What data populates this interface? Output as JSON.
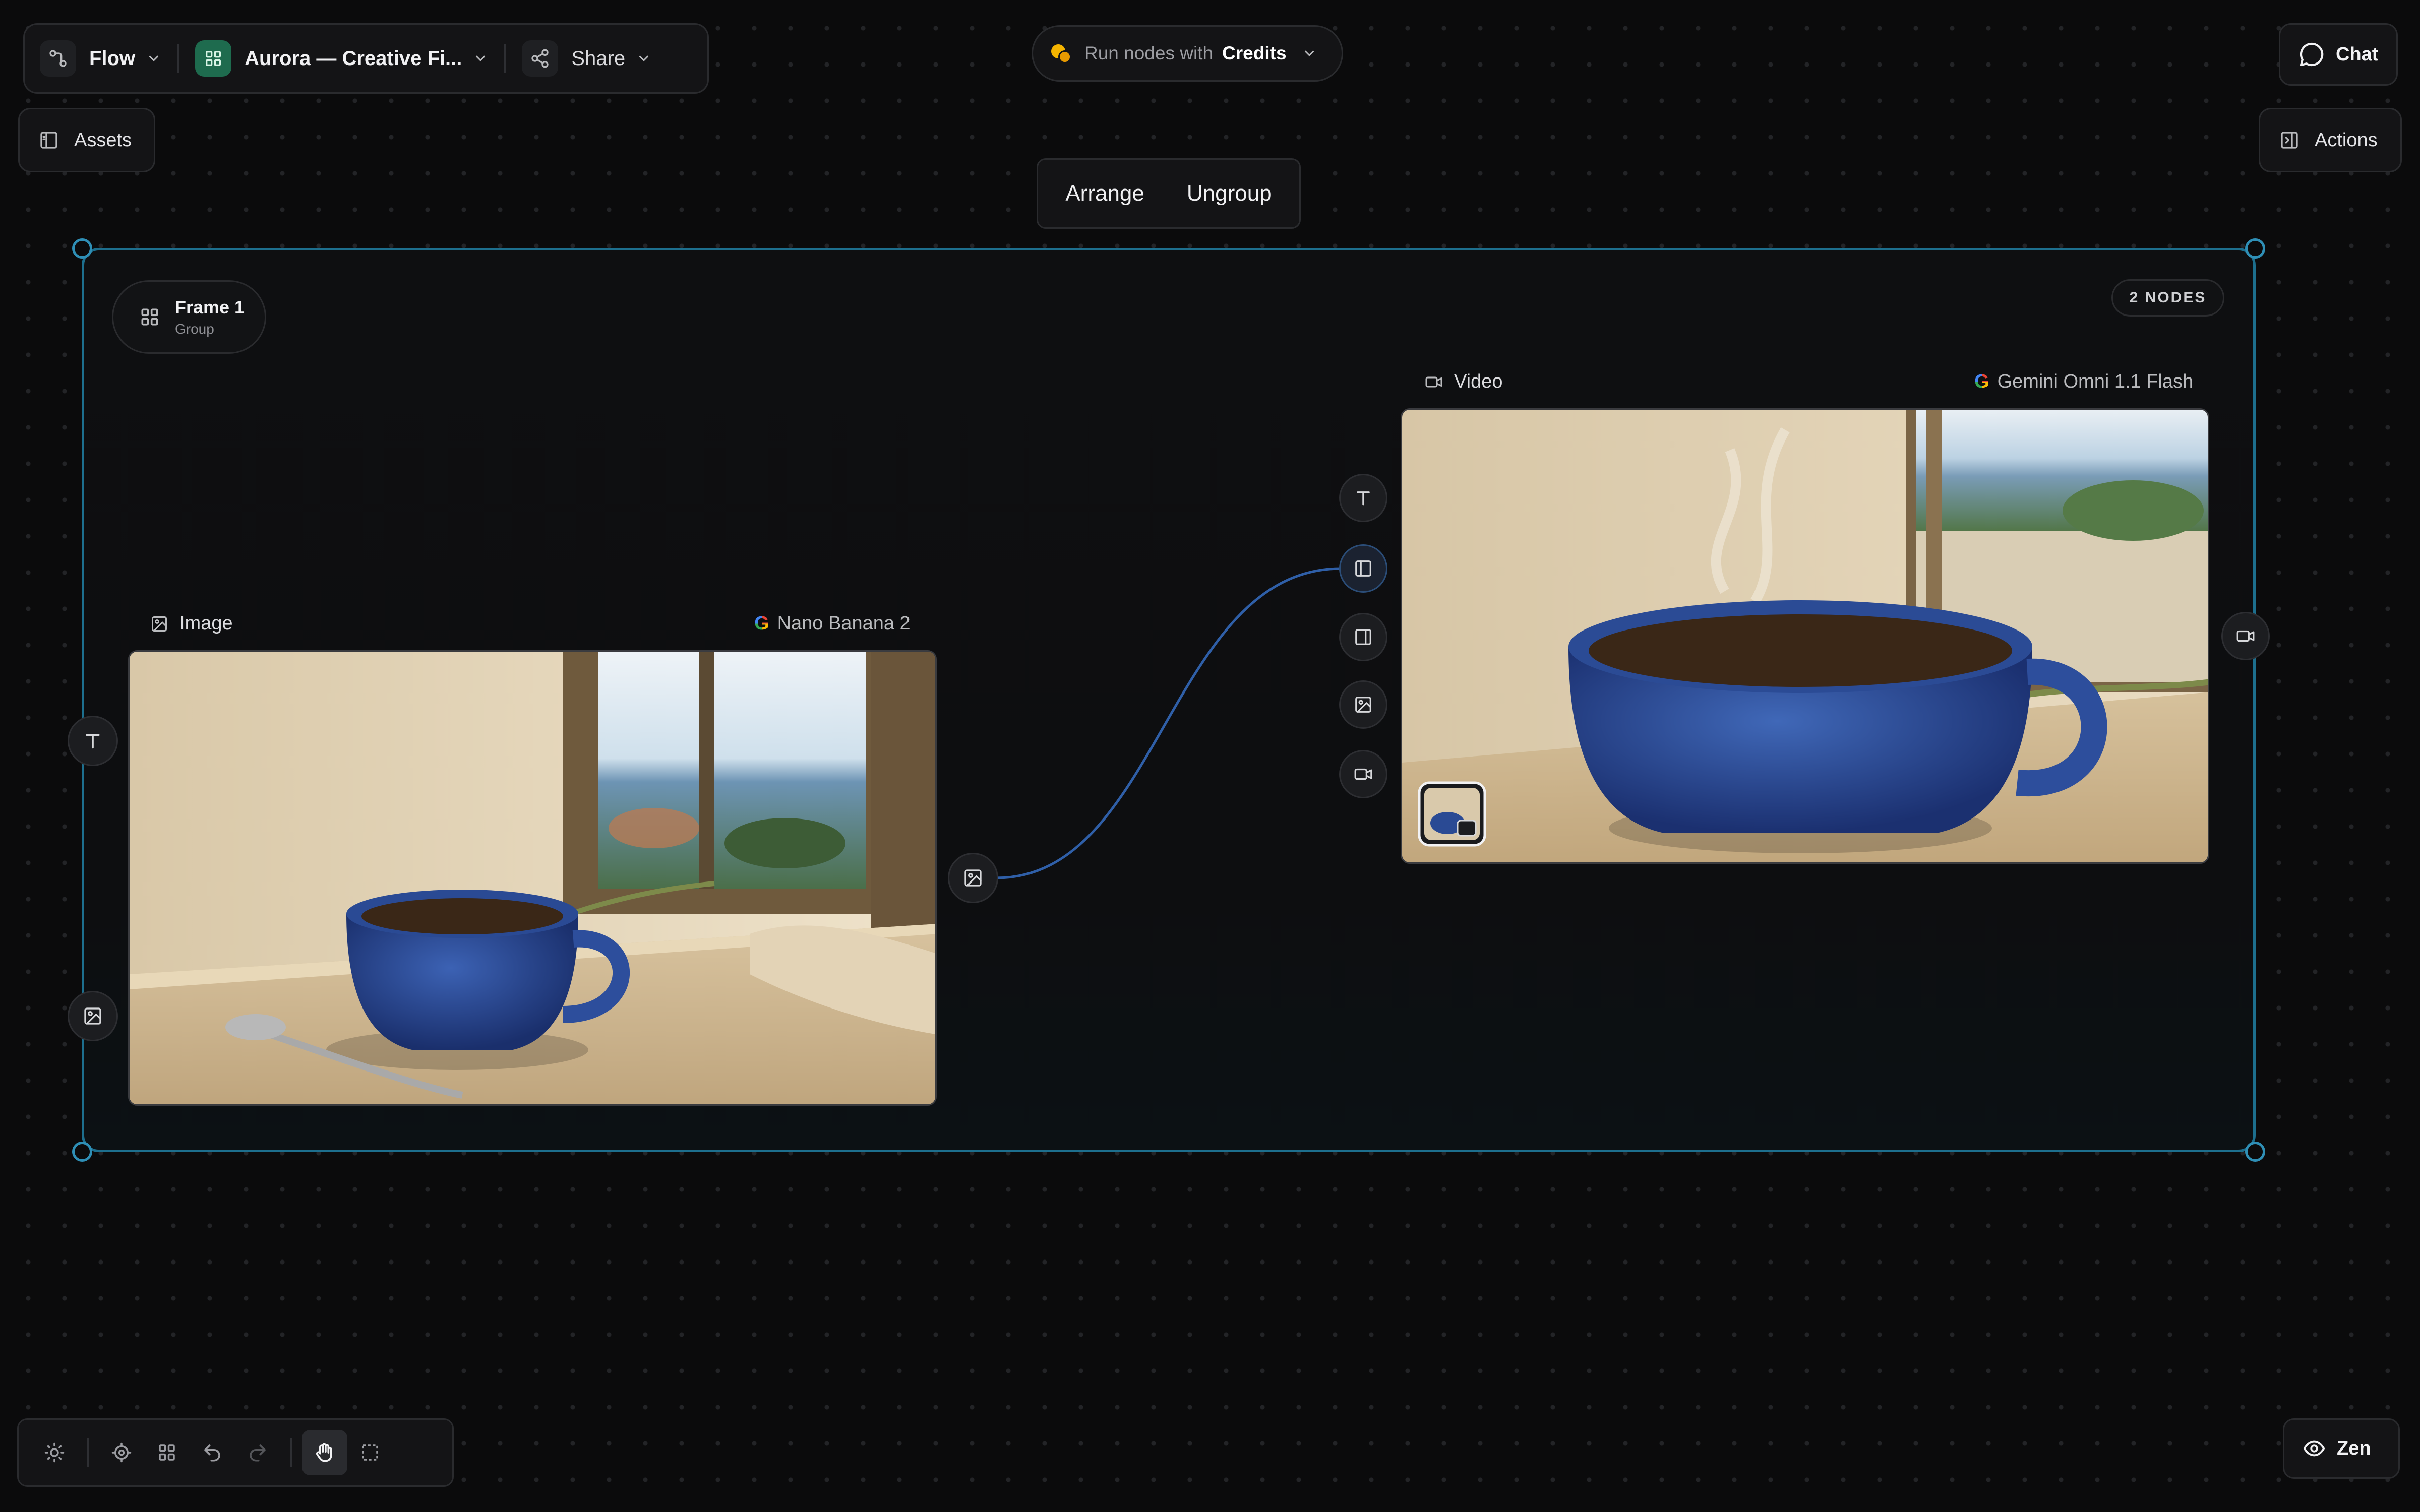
{
  "topbar": {
    "flow_label": "Flow",
    "project_name": "Aurora — Creative Fi...",
    "share_label": "Share"
  },
  "credits": {
    "prefix": "Run nodes with",
    "value": "Credits"
  },
  "chat": {
    "label": "Chat"
  },
  "assets": {
    "label": "Assets"
  },
  "actions": {
    "label": "Actions"
  },
  "group_actions": {
    "arrange": "Arrange",
    "ungroup": "Ungroup"
  },
  "frame": {
    "title": "Frame 1",
    "subtitle": "Group",
    "nodes_badge": "2 NODES",
    "colors": {
      "border": "#1d6f8e",
      "edge": "#2f5fa8"
    }
  },
  "image_node": {
    "type_label": "Image",
    "model_label": "Nano Banana 2"
  },
  "video_node": {
    "type_label": "Video",
    "model_label": "Gemini Omni 1.1 Flash"
  },
  "bottombar": {
    "tools": [
      "sun-icon",
      "target-icon",
      "grid-icon",
      "undo-icon",
      "redo-icon",
      "hand-icon",
      "marquee-icon"
    ],
    "selected_tool": "hand-icon"
  },
  "zen": {
    "label": "Zen"
  }
}
